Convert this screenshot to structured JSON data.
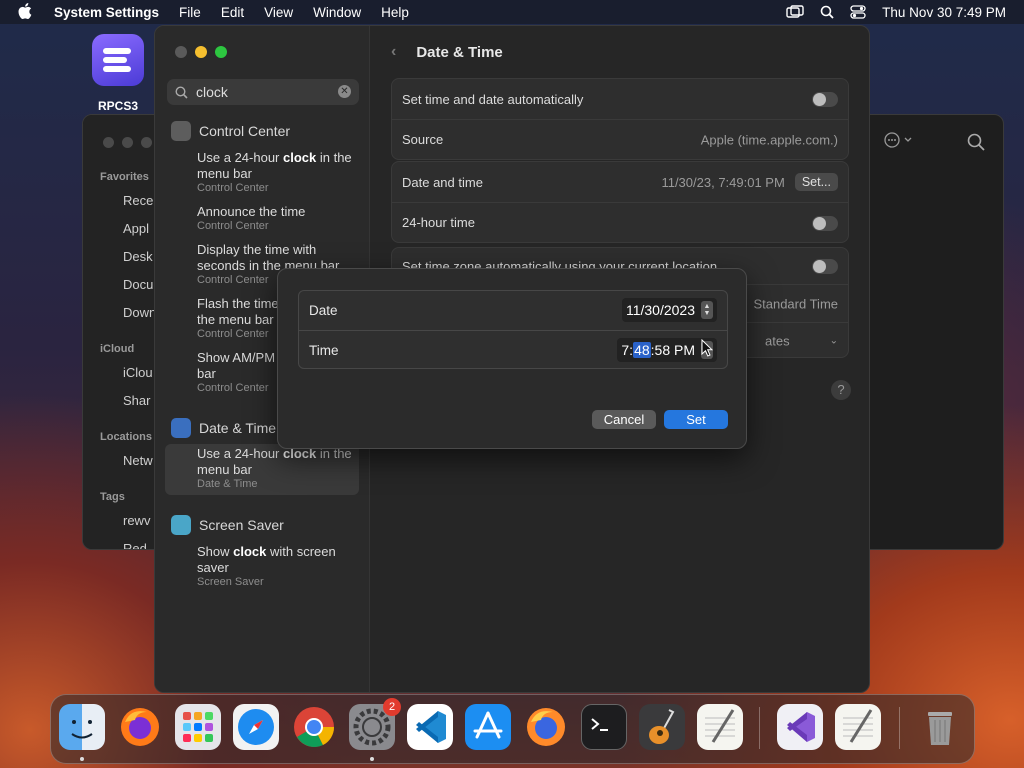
{
  "menubar": {
    "app_name": "System Settings",
    "items": [
      "File",
      "Edit",
      "View",
      "Window",
      "Help"
    ],
    "datetime": "Thu Nov 30  7:49 PM"
  },
  "desktop": {
    "rpcs3_label": "RPCS3"
  },
  "finder": {
    "sections": {
      "favorites": "Favorites",
      "icloud": "iCloud",
      "locations": "Locations",
      "tags": "Tags"
    },
    "items": [
      "Rece",
      "Appl",
      "Desk",
      "Docu",
      "Down",
      "iClou",
      "Shar",
      "Netw",
      "rewv",
      "Red"
    ]
  },
  "sidebar": {
    "search_value": "clock",
    "categories": {
      "control_center": "Control Center",
      "date_time": "Date & Time",
      "screen_saver": "Screen Saver"
    },
    "results": [
      {
        "pre": "Use a 24-hour ",
        "key": "clock",
        "post": " in the menu bar",
        "sub": "Control Center"
      },
      {
        "pre": "Announce the time",
        "key": "",
        "post": "",
        "sub": "Control Center"
      },
      {
        "pre": "Display the time with seconds in the menu bar",
        "key": "",
        "post": "",
        "sub": "Control Center"
      },
      {
        "pre": "Flash the time separators in the menu bar",
        "key": "",
        "post": "",
        "sub": "Control Center"
      },
      {
        "pre": "Show AM/PM in the menu bar",
        "key": "",
        "post": "",
        "sub": "Control Center"
      },
      {
        "pre": "Use a 24-hour ",
        "key": "clock",
        "post": " in the menu bar",
        "sub": "Date & Time"
      },
      {
        "pre": "Show ",
        "key": "clock",
        "post": " with screen saver",
        "sub": "Screen Saver"
      }
    ]
  },
  "main": {
    "title": "Date & Time",
    "auto_label": "Set time and date automatically",
    "source_label": "Source",
    "source_value": "Apple (time.apple.com.)",
    "datetime_label": "Date and time",
    "datetime_value": "11/30/23, 7:49:01 PM",
    "set_button": "Set...",
    "hour24_label": "24-hour time",
    "timezone_auto_label": "Set time zone automatically using your current location",
    "timezone_value": "Standard Time",
    "closest_city_value": "ates",
    "help": "?"
  },
  "dialog": {
    "date_label": "Date",
    "date_value": "11/30/2023",
    "time_label": "Time",
    "time_hour": "7:",
    "time_minute": "48",
    "time_rest": ":58 PM",
    "cancel": "Cancel",
    "set": "Set"
  },
  "dock": {
    "badge_count": "2",
    "apps": [
      "finder",
      "firefox",
      "launchpad",
      "safari",
      "chrome",
      "system-settings",
      "vscode",
      "app-store",
      "firefox-dev",
      "terminal",
      "garageband",
      "textedit",
      "visual-studio",
      "textedit-2",
      "trash"
    ]
  }
}
